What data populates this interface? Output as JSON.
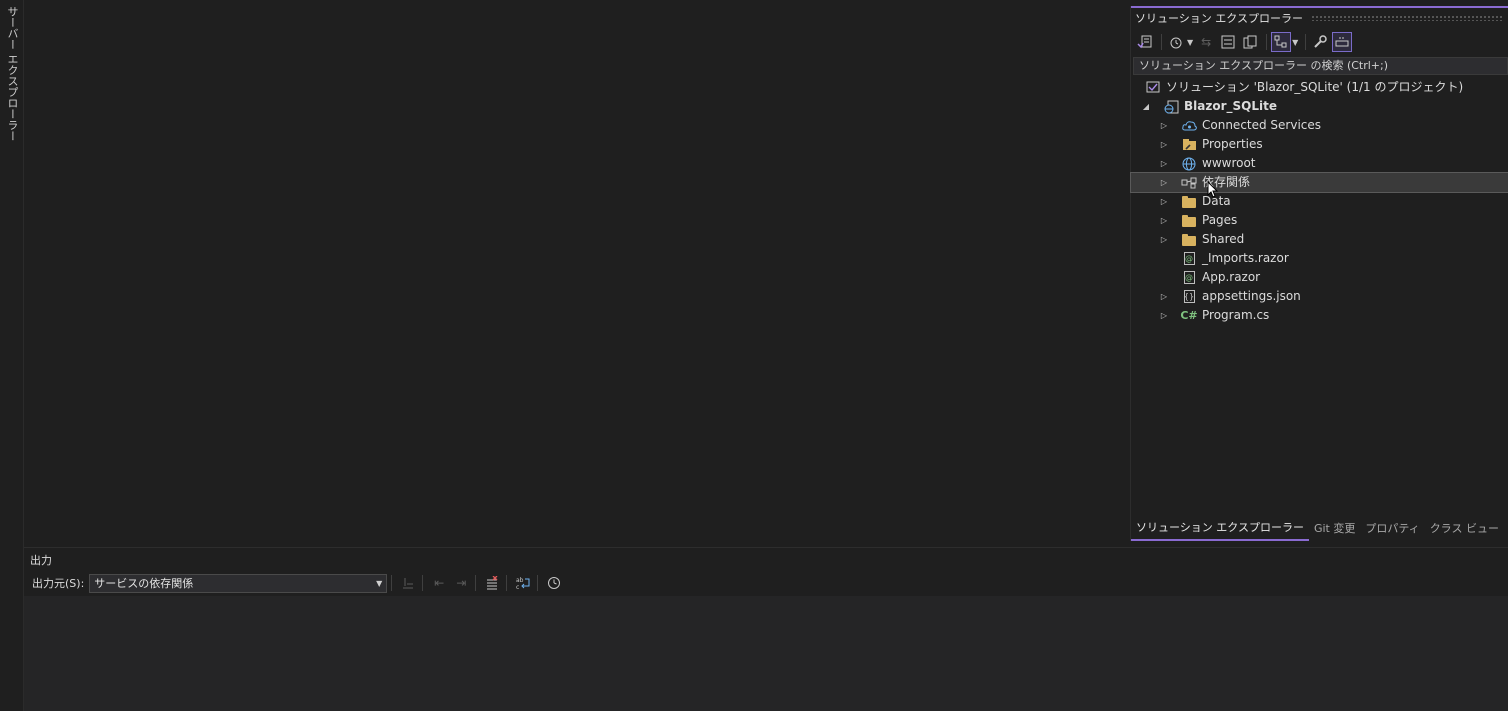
{
  "left_strip": {
    "label": "サーバー エクスプローラー"
  },
  "solution_explorer": {
    "title": "ソリューション エクスプローラー",
    "search_placeholder": "ソリューション エクスプローラー の検索 (Ctrl+;)",
    "tree": [
      {
        "label": "ソリューション 'Blazor_SQLite' (1/1 のプロジェクト)",
        "icon": "solution-icon",
        "expander": "none",
        "level": 0
      },
      {
        "label": "Blazor_SQLite",
        "icon": "web-project-icon",
        "expander": "expanded",
        "level": 0,
        "bold": true
      },
      {
        "label": "Connected Services",
        "icon": "connected-services-icon",
        "expander": "collapsed",
        "level": 1
      },
      {
        "label": "Properties",
        "icon": "properties-icon",
        "expander": "collapsed",
        "level": 1
      },
      {
        "label": "wwwroot",
        "icon": "globe-icon",
        "expander": "collapsed",
        "level": 1
      },
      {
        "label": "依存関係",
        "icon": "dependencies-icon",
        "expander": "collapsed",
        "level": 1,
        "selected": true
      },
      {
        "label": "Data",
        "icon": "folder-icon",
        "expander": "collapsed",
        "level": 1
      },
      {
        "label": "Pages",
        "icon": "folder-icon",
        "expander": "collapsed",
        "level": 1
      },
      {
        "label": "Shared",
        "icon": "folder-icon",
        "expander": "collapsed",
        "level": 1
      },
      {
        "label": "_Imports.razor",
        "icon": "razor-file-icon",
        "expander": "none",
        "level": 1
      },
      {
        "label": "App.razor",
        "icon": "razor-file-icon",
        "expander": "none",
        "level": 1
      },
      {
        "label": "appsettings.json",
        "icon": "json-file-icon",
        "expander": "collapsed",
        "level": 1
      },
      {
        "label": "Program.cs",
        "icon": "csharp-file-icon",
        "expander": "collapsed",
        "level": 1
      }
    ],
    "bottom_tabs": [
      "ソリューション エクスプローラー",
      "Git 変更",
      "プロパティ",
      "クラス ビュー"
    ],
    "accent_color": "#8a6bd1"
  },
  "output": {
    "title": "出力",
    "source_label": "出力元(S):",
    "source_value": "サービスの依存関係"
  }
}
